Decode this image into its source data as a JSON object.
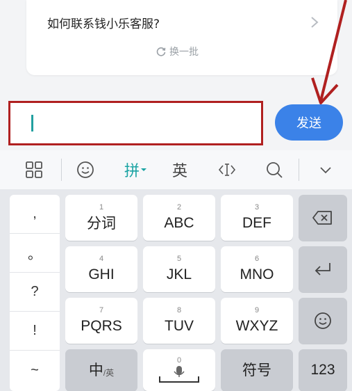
{
  "faq": {
    "question": "如何联系钱小乐客服?",
    "refresh_label": "换一批"
  },
  "input": {
    "placeholder": "",
    "value": ""
  },
  "send_label": "发送",
  "toolbar": {
    "pinyin_label": "拼",
    "english_label": "英"
  },
  "punctuation": [
    ",",
    "。",
    "?",
    "!",
    "~"
  ],
  "keys": [
    {
      "num": "1",
      "label": "分词"
    },
    {
      "num": "2",
      "label": "ABC"
    },
    {
      "num": "3",
      "label": "DEF"
    },
    {
      "num": "4",
      "label": "GHI"
    },
    {
      "num": "5",
      "label": "JKL"
    },
    {
      "num": "6",
      "label": "MNO"
    },
    {
      "num": "7",
      "label": "PQRS"
    },
    {
      "num": "8",
      "label": "TUV"
    },
    {
      "num": "9",
      "label": "WXYZ"
    }
  ],
  "bottom_row": {
    "lang_main": "中",
    "lang_sub": "/英",
    "space_num": "0",
    "symbols": "符号",
    "numbers": "123"
  },
  "colors": {
    "send_button": "#3b82e8",
    "highlight_box": "#b02020",
    "annotation_arrow": "#b02020",
    "pinyin_accent": "#1aa3a3"
  }
}
